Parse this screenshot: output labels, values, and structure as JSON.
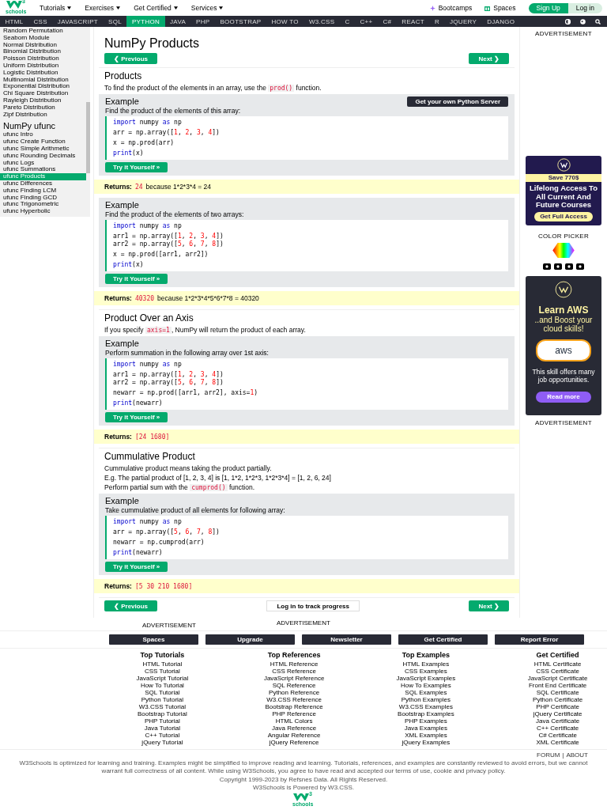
{
  "header": {
    "logo": {
      "mark": "3",
      "word": "schools"
    },
    "menus": [
      "Tutorials",
      "Exercises",
      "Get Certified",
      "Services"
    ],
    "links": [
      {
        "label": "Bootcamps",
        "kind": "sparkle"
      },
      {
        "label": "Spaces",
        "kind": "box"
      }
    ],
    "sign_up": "Sign Up",
    "log_in": "Log in"
  },
  "topics": [
    {
      "label": "HTML",
      "selected": false
    },
    {
      "label": "CSS",
      "selected": false
    },
    {
      "label": "JAVASCRIPT",
      "selected": false
    },
    {
      "label": "SQL",
      "selected": false
    },
    {
      "label": "PYTHON",
      "selected": true
    },
    {
      "label": "JAVA",
      "selected": false
    },
    {
      "label": "PHP",
      "selected": false
    },
    {
      "label": "BOOTSTRAP",
      "selected": false
    },
    {
      "label": "HOW TO",
      "selected": false
    },
    {
      "label": "W3.CSS",
      "selected": false
    },
    {
      "label": "C",
      "selected": false
    },
    {
      "label": "C++",
      "selected": false
    },
    {
      "label": "C#",
      "selected": false
    },
    {
      "label": "REACT",
      "selected": false
    },
    {
      "label": "R",
      "selected": false
    },
    {
      "label": "JQUERY",
      "selected": false
    },
    {
      "label": "DJANGO",
      "selected": false
    }
  ],
  "sidebar": {
    "sections": [
      {
        "items": [
          {
            "label": "Random Permutation",
            "selected": false
          },
          {
            "label": "Seaborn Module",
            "selected": false
          },
          {
            "label": "Normal Distribution",
            "selected": false
          },
          {
            "label": "Binomial Distribution",
            "selected": false
          },
          {
            "label": "Poisson Distribution",
            "selected": false
          },
          {
            "label": "Uniform Distribution",
            "selected": false
          },
          {
            "label": "Logistic Distribution",
            "selected": false
          },
          {
            "label": "Multinomial Distribution",
            "selected": false
          },
          {
            "label": "Exponential Distribution",
            "selected": false
          },
          {
            "label": "Chi Square Distribution",
            "selected": false
          },
          {
            "label": "Rayleigh Distribution",
            "selected": false
          },
          {
            "label": "Pareto Distribution",
            "selected": false
          },
          {
            "label": "Zipf Distribution",
            "selected": false
          }
        ]
      },
      {
        "heading": "NumPy ufunc",
        "items": [
          {
            "label": "ufunc Intro",
            "selected": false
          },
          {
            "label": "ufunc Create Function",
            "selected": false
          },
          {
            "label": "ufunc Simple Arithmetic",
            "selected": false
          },
          {
            "label": "ufunc Rounding Decimals",
            "selected": false
          },
          {
            "label": "ufunc Logs",
            "selected": false
          },
          {
            "label": "ufunc Summations",
            "selected": false
          },
          {
            "label": "ufunc Products",
            "selected": true
          },
          {
            "label": "ufunc Differences",
            "selected": false
          },
          {
            "label": "ufunc Finding LCM",
            "selected": false
          },
          {
            "label": "ufunc Finding GCD",
            "selected": false
          },
          {
            "label": "ufunc Trigonometric",
            "selected": false
          },
          {
            "label": "ufunc Hyperbolic",
            "selected": false
          }
        ]
      }
    ]
  },
  "main": {
    "blocks": [
      {
        "kind": "title",
        "text": "NumPy Products"
      },
      {
        "kind": "pager",
        "previous": "❮ Previous",
        "next": "Next ❯"
      },
      {
        "kind": "rule"
      },
      {
        "kind": "heading",
        "text": "Products"
      },
      {
        "kind": "para",
        "text": [
          "To find the product of the elements in an array, use the ",
          {
            "kind": "code",
            "t": "prod()"
          },
          " function."
        ]
      },
      {
        "kind": "example",
        "title": "Example",
        "server_button": "Get your own Python Server",
        "description": "Find the product of the elements of this array:",
        "try_button": "Try it Yourself »",
        "code": [
          [
            [
              {
                "kind": "keyword",
                "t": "import"
              },
              " numpy ",
              {
                "kind": "keyword",
                "t": "as"
              },
              " np"
            ]
          ],
          [
            [
              "arr = np.array([",
              {
                "kind": "number",
                "t": "1"
              },
              ", ",
              {
                "kind": "number",
                "t": "2"
              },
              ", ",
              {
                "kind": "number",
                "t": "3"
              },
              ", ",
              {
                "kind": "number",
                "t": "4"
              },
              "])"
            ]
          ],
          [
            [
              "x = np.prod(arr)"
            ]
          ],
          [
            [
              {
                "kind": "keyword",
                "t": "print"
              },
              "(x)"
            ]
          ]
        ]
      },
      {
        "kind": "returns",
        "label": "Returns:",
        "value": "24",
        "note": "because 1*2*3*4 = 24"
      },
      {
        "kind": "example",
        "title": "Example",
        "description": "Find the product of the elements of two arrays:",
        "try_button": "Try it Yourself »",
        "code": [
          [
            [
              {
                "kind": "keyword",
                "t": "import"
              },
              " numpy ",
              {
                "kind": "keyword",
                "t": "as"
              },
              " np"
            ]
          ],
          [
            [
              "arr1 = np.array([",
              {
                "kind": "number",
                "t": "1"
              },
              ", ",
              {
                "kind": "number",
                "t": "2"
              },
              ", ",
              {
                "kind": "number",
                "t": "3"
              },
              ", ",
              {
                "kind": "number",
                "t": "4"
              },
              "])"
            ],
            [
              "arr2 = np.array([",
              {
                "kind": "number",
                "t": "5"
              },
              ", ",
              {
                "kind": "number",
                "t": "6"
              },
              ", ",
              {
                "kind": "number",
                "t": "7"
              },
              ", ",
              {
                "kind": "number",
                "t": "8"
              },
              "])"
            ]
          ],
          [
            [
              "x = np.prod([arr1, arr2])"
            ]
          ],
          [
            [
              {
                "kind": "keyword",
                "t": "print"
              },
              "(x)"
            ]
          ]
        ]
      },
      {
        "kind": "returns",
        "label": "Returns:",
        "value": "40320",
        "note": "because 1*2*3*4*5*6*7*8 = 40320"
      },
      {
        "kind": "rule"
      },
      {
        "kind": "heading",
        "text": "Product Over an Axis"
      },
      {
        "kind": "para",
        "text": [
          "If you specify ",
          {
            "kind": "code",
            "t": "axis=1"
          },
          ", NumPy will return the product of each array."
        ]
      },
      {
        "kind": "example",
        "title": "Example",
        "description": "Perform summation in the following array over 1st axis:",
        "try_button": "Try it Yourself »",
        "code": [
          [
            [
              {
                "kind": "keyword",
                "t": "import"
              },
              " numpy ",
              {
                "kind": "keyword",
                "t": "as"
              },
              " np"
            ]
          ],
          [
            [
              "arr1 = np.array([",
              {
                "kind": "number",
                "t": "1"
              },
              ", ",
              {
                "kind": "number",
                "t": "2"
              },
              ", ",
              {
                "kind": "number",
                "t": "3"
              },
              ", ",
              {
                "kind": "number",
                "t": "4"
              },
              "])"
            ],
            [
              "arr2 = np.array([",
              {
                "kind": "number",
                "t": "5"
              },
              ", ",
              {
                "kind": "number",
                "t": "6"
              },
              ", ",
              {
                "kind": "number",
                "t": "7"
              },
              ", ",
              {
                "kind": "number",
                "t": "8"
              },
              "])"
            ]
          ],
          [
            [
              "newarr = np.prod([arr1, arr2], axis=",
              {
                "kind": "number",
                "t": "1"
              },
              ")"
            ]
          ],
          [
            [
              {
                "kind": "keyword",
                "t": "print"
              },
              "(newarr)"
            ]
          ]
        ]
      },
      {
        "kind": "returns",
        "label": "Returns:",
        "value": "[24 1680]"
      },
      {
        "kind": "rule"
      },
      {
        "kind": "heading",
        "text": "Cummulative Product"
      },
      {
        "kind": "para",
        "text": [
          "Cummulative product means taking the product partially."
        ]
      },
      {
        "kind": "para",
        "text": [
          "E.g. The partial product of [1, 2, 3, 4] is [1, 1*2, 1*2*3, 1*2*3*4] = [1, 2, 6, 24]"
        ]
      },
      {
        "kind": "para",
        "text": [
          "Perform partial sum with the ",
          {
            "kind": "code",
            "t": "cumprod()"
          },
          " function."
        ]
      },
      {
        "kind": "example",
        "title": "Example",
        "description": "Take cummulative product of all elements for following array:",
        "try_button": "Try it Yourself »",
        "code": [
          [
            [
              {
                "kind": "keyword",
                "t": "import"
              },
              " numpy ",
              {
                "kind": "keyword",
                "t": "as"
              },
              " np"
            ]
          ],
          [
            [
              "arr = np.array([",
              {
                "kind": "number",
                "t": "5"
              },
              ", ",
              {
                "kind": "number",
                "t": "6"
              },
              ", ",
              {
                "kind": "number",
                "t": "7"
              },
              ", ",
              {
                "kind": "number",
                "t": "8"
              },
              "])"
            ]
          ],
          [
            [
              "newarr = np.cumprod(arr)"
            ]
          ],
          [
            [
              {
                "kind": "keyword",
                "t": "print"
              },
              "(newarr)"
            ]
          ]
        ]
      },
      {
        "kind": "returns",
        "label": "Returns:",
        "value": "[5 30 210 1680]"
      },
      {
        "kind": "rule"
      },
      {
        "kind": "pager",
        "previous": "❮ Previous",
        "track": "Log in to track progress",
        "next": "Next ❯"
      }
    ]
  },
  "aside": {
    "top_label": "ADVERTISEMENT",
    "promo": {
      "badge": "Save 770$",
      "headline": "Lifelong Access To All Current And Future Courses",
      "button": "Get Full Access"
    },
    "color_picker": "COLOR PICKER",
    "aws": {
      "title": "Learn AWS",
      "subtitle": "..and Boost your cloud skills!",
      "logo": "aws",
      "text": "This skill offers many job opportunities.",
      "button": "Read more"
    },
    "bottom_label": "ADVERTISEMENT"
  },
  "footer": {
    "ads": [
      "ADVERTISEMENT",
      "ADVERTISEMENT"
    ],
    "buttons": [
      "Spaces",
      "Upgrade",
      "Newsletter",
      "Get Certified",
      "Report Error"
    ],
    "columns": [
      {
        "heading": "Top Tutorials",
        "links": [
          "HTML Tutorial",
          "CSS Tutorial",
          "JavaScript Tutorial",
          "How To Tutorial",
          "SQL Tutorial",
          "Python Tutorial",
          "W3.CSS Tutorial",
          "Bootstrap Tutorial",
          "PHP Tutorial",
          "Java Tutorial",
          "C++ Tutorial",
          "jQuery Tutorial"
        ]
      },
      {
        "heading": "Top References",
        "links": [
          "HTML Reference",
          "CSS Reference",
          "JavaScript Reference",
          "SQL Reference",
          "Python Reference",
          "W3.CSS Reference",
          "Bootstrap Reference",
          "PHP Reference",
          "HTML Colors",
          "Java Reference",
          "Angular Reference",
          "jQuery Reference"
        ]
      },
      {
        "heading": "Top Examples",
        "links": [
          "HTML Examples",
          "CSS Examples",
          "JavaScript Examples",
          "How To Examples",
          "SQL Examples",
          "Python Examples",
          "W3.CSS Examples",
          "Bootstrap Examples",
          "PHP Examples",
          "Java Examples",
          "XML Examples",
          "jQuery Examples"
        ]
      },
      {
        "heading": "Get Certified",
        "links": [
          "HTML Certificate",
          "CSS Certificate",
          "JavaScript Certificate",
          "Front End Certificate",
          "SQL Certificate",
          "Python Certificate",
          "PHP Certificate",
          "jQuery Certificate",
          "Java Certificate",
          "C++ Certificate",
          "C# Certificate",
          "XML Certificate"
        ]
      }
    ],
    "links": [
      "FORUM",
      "ABOUT"
    ],
    "separator": "|",
    "disclaimer": "W3Schools is optimized for learning and training. Examples might be simplified to improve reading and learning. Tutorials, references, and examples are constantly reviewed to avoid errors, but we cannot warrant full correctness of all content. While using W3Schools, you agree to have read and accepted our terms of use, cookie and privacy policy.",
    "copyright": [
      "Copyright 1999-2023 by Refsnes Data. All Rights Reserved.",
      "W3Schools is Powered by W3.CSS."
    ],
    "logo": {
      "mark": "3",
      "word": "schools"
    }
  }
}
